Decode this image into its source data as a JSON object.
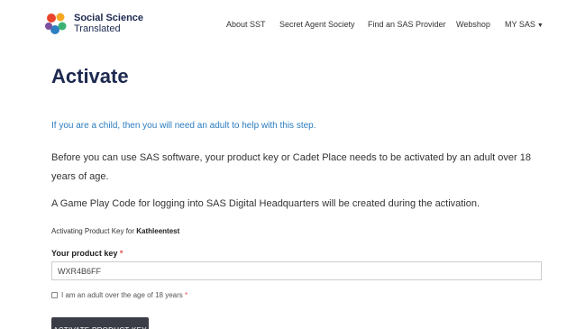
{
  "header": {
    "brand_line1": "Social Science",
    "brand_line2": "Translated",
    "nav": {
      "about": "About SST",
      "secret_agent": "Secret Agent Society",
      "find_provider": "Find an SAS Provider",
      "webshop": "Webshop",
      "my_sas": "MY SAS"
    }
  },
  "main": {
    "title": "Activate",
    "child_note": "If you are a child, then you will need an adult to help with this step.",
    "paragraph1": "Before you can use SAS software, your product key or Cadet Place needs to be activated by an adult over 18 years of age.",
    "paragraph2": "A Game Play Code for logging into SAS Digital Headquarters will be created during the activation.",
    "activating_prefix": "Activating Product Key for ",
    "activating_user": "Kathleentest",
    "product_key_label": "Your product key",
    "required_marker": "*",
    "product_key_value": "WXR4B6FF",
    "agree_label": "I am an adult over the age of 18 years",
    "activate_button": "ACTIVATE PRODUCT KEY"
  },
  "colors": {
    "brand_navy": "#1d2950",
    "link_blue": "#2b7cc0",
    "required_red": "#e24b4b",
    "button_dark": "#3a3d45",
    "logo_colors": [
      "#e8452c",
      "#f6a821",
      "#3bb273",
      "#2d7fc1",
      "#7a4fa0"
    ]
  }
}
